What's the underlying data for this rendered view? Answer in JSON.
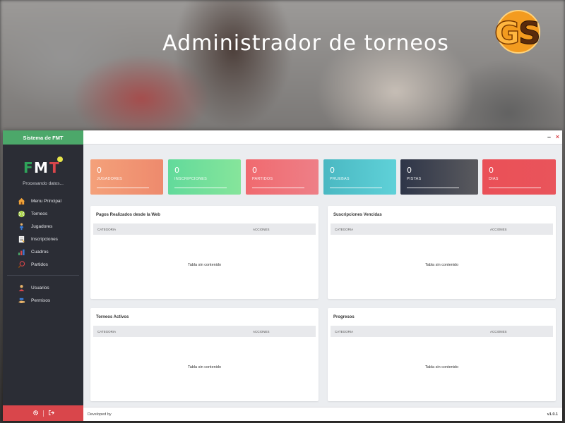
{
  "hero": {
    "title": "Administrador de torneos",
    "logo_text": "GS"
  },
  "sidebar": {
    "header": "Sistema de FMT",
    "logo_text": "FMT",
    "status": "Procesando datos...",
    "menu_primary": [
      {
        "label": "Menu Principal",
        "icon": "home-icon"
      },
      {
        "label": "Torneos",
        "icon": "tennis-ball-icon"
      },
      {
        "label": "Jugadores",
        "icon": "player-icon"
      },
      {
        "label": "Inscripciones",
        "icon": "document-icon"
      },
      {
        "label": "Cuadros",
        "icon": "chart-icon"
      },
      {
        "label": "Partidos",
        "icon": "racket-icon"
      }
    ],
    "menu_secondary": [
      {
        "label": "Usuarios",
        "icon": "user-icon"
      },
      {
        "label": "Permisos",
        "icon": "permissions-icon"
      }
    ],
    "footer_icons": [
      "settings-icon",
      "logout-icon"
    ]
  },
  "window_controls": {
    "minimize": "–",
    "close": "×"
  },
  "stats": [
    {
      "value": "0",
      "label": "JUGADORES",
      "color_from": "#f4a17a",
      "color_to": "#ee8a6d"
    },
    {
      "value": "0",
      "label": "INSCRIPCIONES",
      "color_from": "#62da9b",
      "color_to": "#86e59b"
    },
    {
      "value": "0",
      "label": "PARTIDOS",
      "color_from": "#f06a6f",
      "color_to": "#ee7f87"
    },
    {
      "value": "0",
      "label": "PRUEBAS",
      "color_from": "#4ab8c2",
      "color_to": "#5fd1d8"
    },
    {
      "value": "0",
      "label": "PISTAS",
      "color_from": "#2e3548",
      "color_to": "#5a5a5e"
    },
    {
      "value": "0",
      "label": "DIAS",
      "color_from": "#ea5057",
      "color_to": "#e9545b"
    }
  ],
  "panels": [
    {
      "title": "Pagos Realizados desde la Web",
      "col1": "CATEGORIA",
      "col2": "ACCIONES",
      "empty": "Tabla sin contenido"
    },
    {
      "title": "Suscripciones Vencidas",
      "col1": "CATEGORIA",
      "col2": "ACCIONES",
      "empty": "Tabla sin contenido"
    },
    {
      "title": "Torneos Activos",
      "col1": "CATEGORIA",
      "col2": "ACCIONES",
      "empty": "Tabla sin contenido"
    },
    {
      "title": "Progresos",
      "col1": "CATEGORIA",
      "col2": "ACCIONES",
      "empty": "Tabla sin contenido"
    }
  ],
  "footer": {
    "left": "Developed by",
    "version": "v1.0.1"
  }
}
